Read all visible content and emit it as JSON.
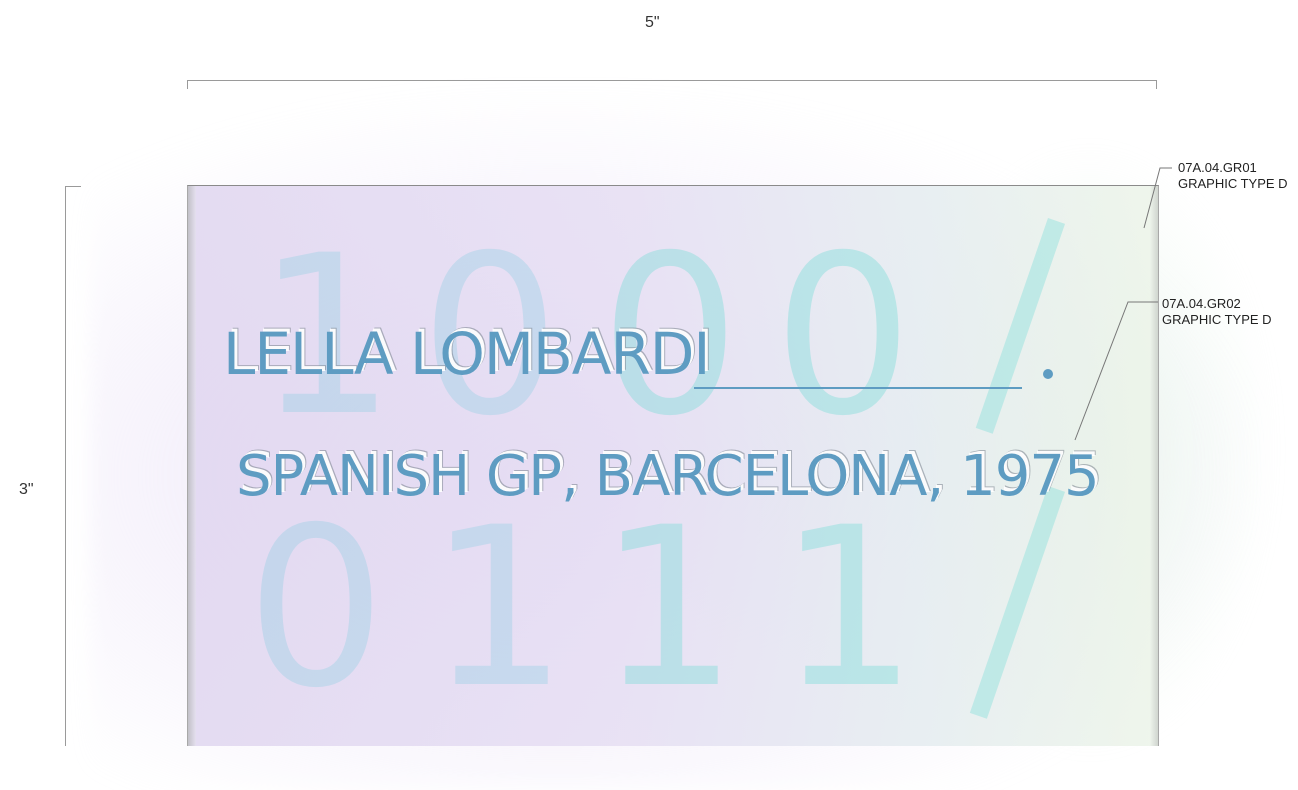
{
  "dimensions": {
    "width_label": "5\"",
    "height_label": "3\""
  },
  "sign": {
    "name": "LELLA LOMBARDI",
    "race": "SPANISH GP, BARCELONA, 1975",
    "background_row1": [
      "1",
      "0",
      "0",
      "0",
      "/"
    ],
    "background_row2": [
      "0",
      "1",
      "1",
      "1",
      "/"
    ]
  },
  "callouts": [
    {
      "code": "07A.04.GR01",
      "type": "GRAPHIC TYPE D"
    },
    {
      "code": "07A.04.GR02",
      "type": "GRAPHIC TYPE D"
    }
  ],
  "colors": {
    "text_blue": "#5e9cc2",
    "numeral_teal": "#8cdcd8",
    "panel_lilac": "#e0d6f0"
  }
}
